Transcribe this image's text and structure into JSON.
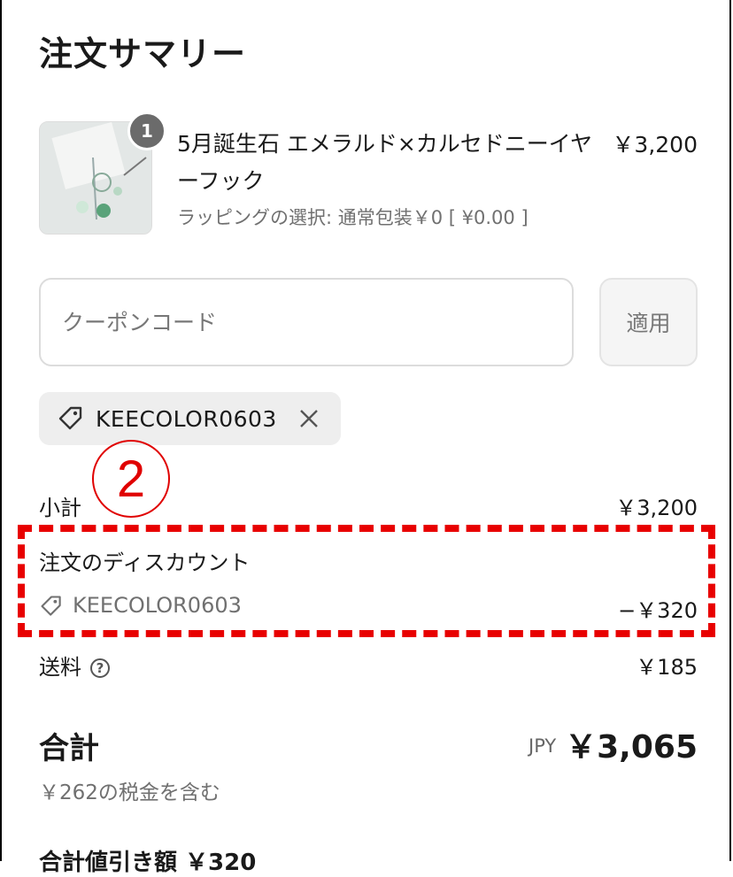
{
  "summary": {
    "title": "注文サマリー"
  },
  "item": {
    "quantity": "1",
    "name": "5月誕生石 エメラルド×カルセドニーイヤーフック",
    "price": "￥3,200",
    "variant": "ラッピングの選択: 通常包装￥0 [ ¥0.00 ]"
  },
  "coupon": {
    "placeholder": "クーポンコード",
    "apply_label": "適用"
  },
  "applied_code": {
    "code": "KEECOLOR0603"
  },
  "annotation": {
    "label": "2"
  },
  "lines": {
    "subtotal_label": "小計",
    "subtotal_value": "￥3,200",
    "discount_label": "注文のディスカウント",
    "discount_code": "KEECOLOR0603",
    "discount_value": "−￥320",
    "shipping_label": "送料",
    "shipping_value": "￥185"
  },
  "total": {
    "label": "合計",
    "currency": "JPY",
    "value": "￥3,065",
    "tax_note": "￥262の税金を含む"
  },
  "footer": {
    "cut_text": "合計値引き額 ￥320"
  },
  "colors": {
    "annotation": "#e80000"
  }
}
